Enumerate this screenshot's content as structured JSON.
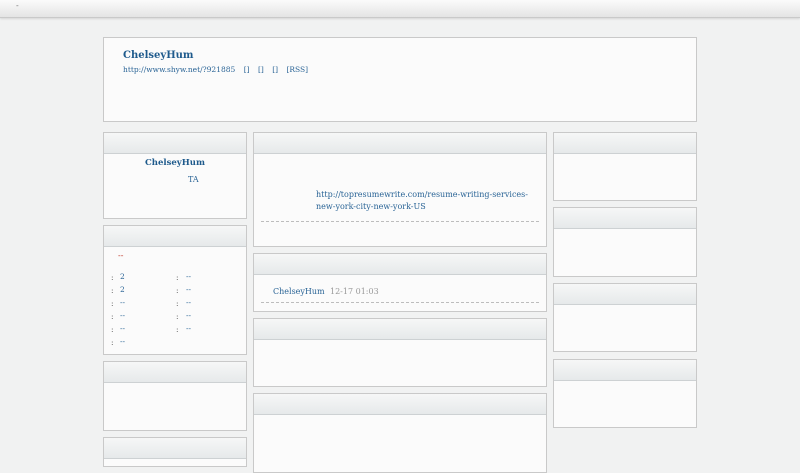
{
  "topbar": {
    "marker": "-"
  },
  "blog": {
    "title": "ChelseyHum",
    "links": [
      "http://www.shyw.net/?921885",
      "[]",
      "[]",
      "[]",
      "[RSS]"
    ]
  },
  "profile": {
    "name": "ChelseyHum",
    "ta_link": "TA"
  },
  "stats": {
    "red_text": "--",
    "rows": [
      {
        "left": "2",
        "right": "--"
      },
      {
        "left": "2",
        "right": "--"
      },
      {
        "left": "--",
        "right": "--"
      },
      {
        "left": "--",
        "right": "--"
      },
      {
        "left": "--",
        "right": "--"
      },
      {
        "left": "--",
        "right": ""
      }
    ]
  },
  "article": {
    "link": "http://topresumewrite.com/resume-writing-services-new-york-city-new-york-US"
  },
  "comment": {
    "author": "ChelseyHum",
    "time": "12-17 01:03"
  }
}
